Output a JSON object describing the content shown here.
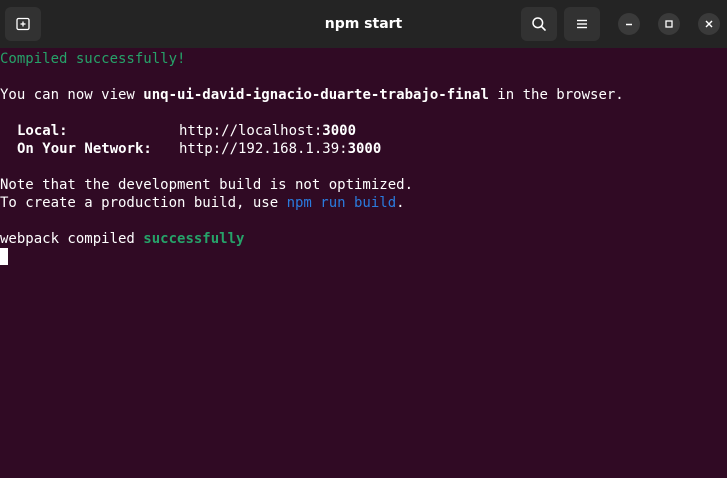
{
  "window": {
    "title": "npm start"
  },
  "icons": {
    "new_tab": "new-tab-icon",
    "search": "search-icon",
    "menu": "hamburger-menu-icon",
    "minimize": "minimize-icon",
    "maximize": "maximize-icon",
    "close": "close-icon"
  },
  "colors": {
    "background": "#300a24",
    "titlebar": "#242424",
    "success_green": "#26a269",
    "link_blue": "#2a7bde"
  },
  "terminal": {
    "compiled": "Compiled successfully!",
    "view_prefix": "You can now view ",
    "app_name": "unq-ui-david-ignacio-duarte-trabajo-final",
    "view_suffix": " in the browser.",
    "local_label": "Local:",
    "local_url_prefix": "http://localhost:",
    "local_port": "3000",
    "network_label": "On Your Network:",
    "network_url_prefix": "http://192.168.1.39:",
    "network_port": "3000",
    "note_line": "Note that the development build is not optimized.",
    "prod_prefix": "To create a production build, use ",
    "prod_command": "npm run build",
    "prod_suffix": ".",
    "webpack_prefix": "webpack compiled ",
    "webpack_status": "successfully"
  }
}
